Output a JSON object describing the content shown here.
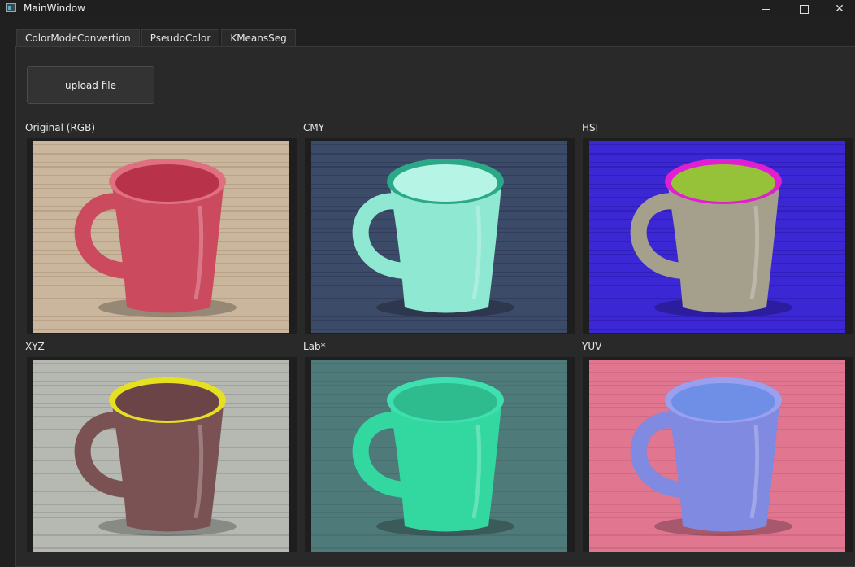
{
  "window": {
    "title": "MainWindow"
  },
  "tabs": [
    {
      "label": "ColorModeConvertion",
      "active": true
    },
    {
      "label": "PseudoColor",
      "active": false
    },
    {
      "label": "KMeansSeg",
      "active": false
    }
  ],
  "upload_button": {
    "label": "upload file"
  },
  "images": [
    {
      "label": "Original (RGB)",
      "bg": "#c9b69c",
      "stripe": "#a99478",
      "mug": "#cc4a5e",
      "inner": "#b83249",
      "accent": "#e07080"
    },
    {
      "label": "CMY",
      "bg": "#3c4b68",
      "stripe": "#2a3450",
      "mug": "#8fe8d2",
      "inner": "#b6f5e6",
      "accent": "#2aa887"
    },
    {
      "label": "HSI",
      "bg": "#3b27d4",
      "stripe": "#2c1aa6",
      "mug": "#a4a08c",
      "inner": "#96c23a",
      "accent": "#e01fd0"
    },
    {
      "label": "XYZ",
      "bg": "#b6b9b2",
      "stripe": "#8e928c",
      "mug": "#7a5254",
      "inner": "#6a4446",
      "accent": "#e5e020"
    },
    {
      "label": "Lab*",
      "bg": "#4f7a7a",
      "stripe": "#43686a",
      "mug": "#33d8a0",
      "inner": "#2ebc8e",
      "accent": "#3fe0b0"
    },
    {
      "label": "YUV",
      "bg": "#e07690",
      "stripe": "#c86078",
      "mug": "#7f8ae0",
      "inner": "#6f8fe6",
      "accent": "#9aa0f0"
    }
  ]
}
